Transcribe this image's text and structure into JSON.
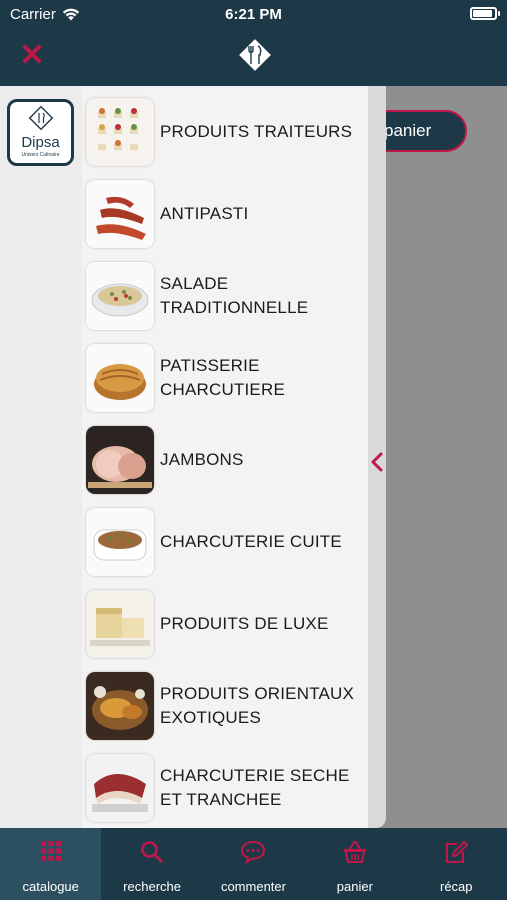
{
  "status_bar": {
    "carrier": "Carrier",
    "time": "6:21 PM",
    "battery_level": 0.85
  },
  "header": {
    "close_icon": "close-x-icon",
    "logo_icon": "fork-knife-diamond-icon"
  },
  "background": {
    "panier_label": "panier"
  },
  "brand": {
    "name": "Dipsa",
    "tagline": "Univers Culinaire"
  },
  "categories": [
    {
      "label": "PRODUITS TRAITEURS",
      "thumb_icon": "petits-fours-image"
    },
    {
      "label": "ANTIPASTI",
      "thumb_icon": "antipasti-image"
    },
    {
      "label": "SALADE TRADITIONNELLE",
      "thumb_icon": "salad-image"
    },
    {
      "label": "PATISSERIE CHARCUTIERE",
      "thumb_icon": "pastry-image"
    },
    {
      "label": "JAMBONS",
      "thumb_icon": "ham-image"
    },
    {
      "label": "CHARCUTERIE CUITE",
      "thumb_icon": "terrine-image"
    },
    {
      "label": "PRODUITS DE LUXE",
      "thumb_icon": "foie-gras-image"
    },
    {
      "label": "PRODUITS ORIENTAUX EXOTIQUES",
      "thumb_icon": "oriental-dish-image"
    },
    {
      "label": "CHARCUTERIE SECHE ET TRANCHEE",
      "thumb_icon": "dry-sausage-image"
    }
  ],
  "tabs": [
    {
      "label": "catalogue",
      "icon": "grid-icon",
      "active": true
    },
    {
      "label": "recherche",
      "icon": "search-icon",
      "active": false
    },
    {
      "label": "commenter",
      "icon": "comment-icon",
      "active": false
    },
    {
      "label": "panier",
      "icon": "basket-icon",
      "active": false
    },
    {
      "label": "récap",
      "icon": "edit-icon",
      "active": false
    }
  ],
  "colors": {
    "navy": "#1d3947",
    "accent": "#c0174a",
    "drawer": "#f3f3f3",
    "overlay": "#8f8f8f"
  }
}
